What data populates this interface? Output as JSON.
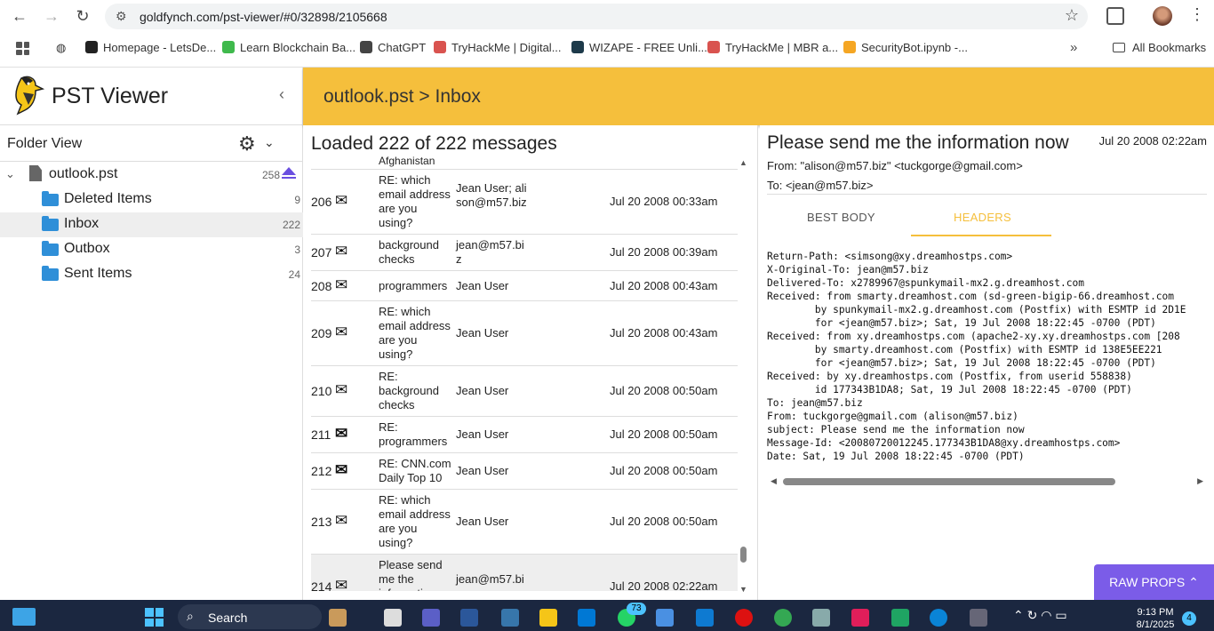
{
  "browser": {
    "url": "goldfynch.com/pst-viewer/#0/32898/2105668",
    "bookmarks": [
      {
        "label": "Homepage - LetsDe...",
        "color": "#222222"
      },
      {
        "label": "Learn Blockchain Ba...",
        "color": "#3fb94c"
      },
      {
        "label": "ChatGPT",
        "color": "#444444"
      },
      {
        "label": "TryHackMe | Digital...",
        "color": "#d9534f"
      },
      {
        "label": "WIZAPE - FREE Unli...",
        "color": "#1d3a4a"
      },
      {
        "label": "TryHackMe | MBR a...",
        "color": "#d9534f"
      },
      {
        "label": "SecurityBot.ipynb -...",
        "color": "#f5a623"
      }
    ],
    "all_bookmarks": "All Bookmarks"
  },
  "sidebar": {
    "app_title": "PST Viewer",
    "folder_view_label": "Folder View",
    "root": {
      "label": "outlook.pst",
      "count": "258"
    },
    "folders": [
      {
        "label": "Deleted Items",
        "count": "9"
      },
      {
        "label": "Inbox",
        "count": "222"
      },
      {
        "label": "Outbox",
        "count": "3"
      },
      {
        "label": "Sent Items",
        "count": "24"
      }
    ]
  },
  "header": {
    "breadcrumb": "outlook.pst > Inbox"
  },
  "list": {
    "loaded_text": "Loaded 222 of 222 messages",
    "partial_top_subject": "Afghanistan",
    "rows": [
      {
        "num": "206",
        "subject": "RE: which email address are you using?",
        "from": "Jean User; alison@m57.biz",
        "date": "Jul 20 2008 00:33am",
        "read": true
      },
      {
        "num": "207",
        "subject": "background checks",
        "from": "jean@m57.biz",
        "date": "Jul 20 2008 00:39am",
        "read": true
      },
      {
        "num": "208",
        "subject": "programmers",
        "from": "Jean User",
        "date": "Jul 20 2008 00:43am",
        "read": true
      },
      {
        "num": "209",
        "subject": "RE: which email address are you using?",
        "from": "Jean User",
        "date": "Jul 20 2008 00:43am",
        "read": true
      },
      {
        "num": "210",
        "subject": "RE: background checks",
        "from": "Jean User",
        "date": "Jul 20 2008 00:50am",
        "read": true
      },
      {
        "num": "211",
        "subject": "RE: programmers",
        "from": "Jean User",
        "date": "Jul 20 2008 00:50am",
        "read": false
      },
      {
        "num": "212",
        "subject": "RE: CNN.com Daily Top 10",
        "from": "Jean User",
        "date": "Jul 20 2008 00:50am",
        "read": false
      },
      {
        "num": "213",
        "subject": "RE: which email address are you using?",
        "from": "Jean User",
        "date": "Jul 20 2008 00:50am",
        "read": true
      },
      {
        "num": "214",
        "subject": "Please send me the information now",
        "from": "jean@m57.biz",
        "date": "Jul 20 2008 02:22am",
        "read": true
      }
    ]
  },
  "reader": {
    "subject": "Please send me the information now",
    "date": "Jul 20 2008 02:22am",
    "from": "From: \"alison@m57.biz\" <tuckgorge@gmail.com>",
    "to": "To: <jean@m57.biz>",
    "tabs": [
      "BEST BODY",
      "HEADERS"
    ],
    "active_tab": "HEADERS",
    "headers": "Return-Path: <simsong@xy.dreamhostps.com>\nX-Original-To: jean@m57.biz\nDelivered-To: x2789967@spunkymail-mx2.g.dreamhost.com\nReceived: from smarty.dreamhost.com (sd-green-bigip-66.dreamhost.com\n        by spunkymail-mx2.g.dreamhost.com (Postfix) with ESMTP id 2D1E\n        for <jean@m57.biz>; Sat, 19 Jul 2008 18:22:45 -0700 (PDT)\nReceived: from xy.dreamhostps.com (apache2-xy.xy.dreamhostps.com [208\n        by smarty.dreamhost.com (Postfix) with ESMTP id 138E5EE221\n        for <jean@m57.biz>; Sat, 19 Jul 2008 18:22:45 -0700 (PDT)\nReceived: by xy.dreamhostps.com (Postfix, from userid 558838)\n        id 177343B1DA8; Sat, 19 Jul 2008 18:22:45 -0700 (PDT)\nTo: jean@m57.biz\nFrom: tuckgorge@gmail.com (alison@m57.biz)\nsubject: Please send me the information now\nMessage-Id: <20080720012245.177343B1DA8@xy.dreamhostps.com>\nDate: Sat, 19 Jul 2008 18:22:45 -0700 (PDT)",
    "raw_props_label": "RAW PROPS"
  },
  "taskbar": {
    "search_label": "Search",
    "whatsapp_badge": "73",
    "time": "9:13 PM",
    "date": "8/1/2025",
    "notifications": "4"
  },
  "colors": {
    "accent": "#f5bf3c",
    "raw_props": "#7b5ce8",
    "folder": "#2f8fd8"
  }
}
